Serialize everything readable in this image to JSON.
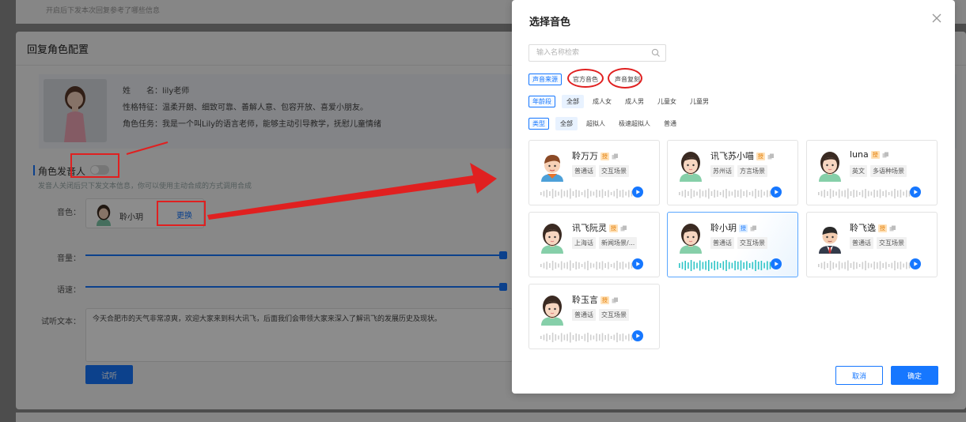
{
  "background": {
    "top_hint": "开启后下发本次回复参考了哪些信息",
    "section_title": "回复角色配置",
    "profile": {
      "name_key": "姓　　名：",
      "name_value": "lily老师",
      "trait_key": "性格特征：",
      "trait_value": "温柔开朗、细致可靠、善解人意、包容开放、喜爱小朋友。",
      "task_key": "角色任务：",
      "task_value": "我是一个叫Lily的语言老师，能够主动引导教学，抚慰儿童情绪"
    },
    "role_speaker_label": "角色发音人",
    "role_speaker_hint": "发音人关闭后只下发文本信息，你可以使用主动合成的方式调用合成",
    "voice_label": "音色：",
    "voice_current": "聆小玥",
    "change_label": "更换",
    "volume_label": "音量：",
    "speed_label": "语速：",
    "trial_text_label": "试听文本：",
    "trial_text": "今天合肥市的天气非常凉爽，欢迎大家来到科大讯飞，后面我们会带领大家来深入了解讯飞的发展历史及现状。",
    "listen_button": "试听"
  },
  "modal": {
    "title": "选择音色",
    "search_placeholder": "输入名称检索",
    "filters": {
      "source": {
        "key": "声音来源",
        "options": [
          "官方音色",
          "声音复刻"
        ],
        "active": -1
      },
      "age": {
        "key": "年龄段",
        "options": [
          "全部",
          "成人女",
          "成人男",
          "儿童女",
          "儿童男"
        ],
        "active": 0
      },
      "type": {
        "key": "类型",
        "options": [
          "全部",
          "超拟人",
          "极速超拟人",
          "普通"
        ],
        "active": 0
      }
    },
    "badge_text": "授",
    "voices": [
      {
        "name": "聆万万",
        "tags": [
          "普通话",
          "交互场景"
        ],
        "avatar": "boy-avatar",
        "badge": "orange",
        "selected": false
      },
      {
        "name": "讯飞苏小喵",
        "tags": [
          "苏州话",
          "方言场景"
        ],
        "avatar": "girl-avatar",
        "badge": "orange",
        "selected": false
      },
      {
        "name": "luna",
        "tags": [
          "英文",
          "多语种场景"
        ],
        "avatar": "girl-avatar",
        "badge": "orange",
        "selected": false
      },
      {
        "name": "讯飞阮灵",
        "tags": [
          "上海话",
          "新闻场景/..."
        ],
        "avatar": "girl-avatar",
        "badge": "orange",
        "selected": false
      },
      {
        "name": "聆小玥",
        "tags": [
          "普通话",
          "交互场景"
        ],
        "avatar": "girl-avatar",
        "badge": "blue",
        "selected": true
      },
      {
        "name": "聆飞逸",
        "tags": [
          "普通话",
          "交互场景"
        ],
        "avatar": "man-avatar",
        "badge": "orange",
        "selected": false
      },
      {
        "name": "聆玉言",
        "tags": [
          "普通话",
          "交互场景"
        ],
        "avatar": "girl-avatar",
        "badge": "orange",
        "selected": false
      }
    ],
    "cancel_label": "取消",
    "ok_label": "确定"
  },
  "colors": {
    "accent": "#1677ff",
    "annotation": "#e02020",
    "selected_wave": "#2ec4c6"
  }
}
